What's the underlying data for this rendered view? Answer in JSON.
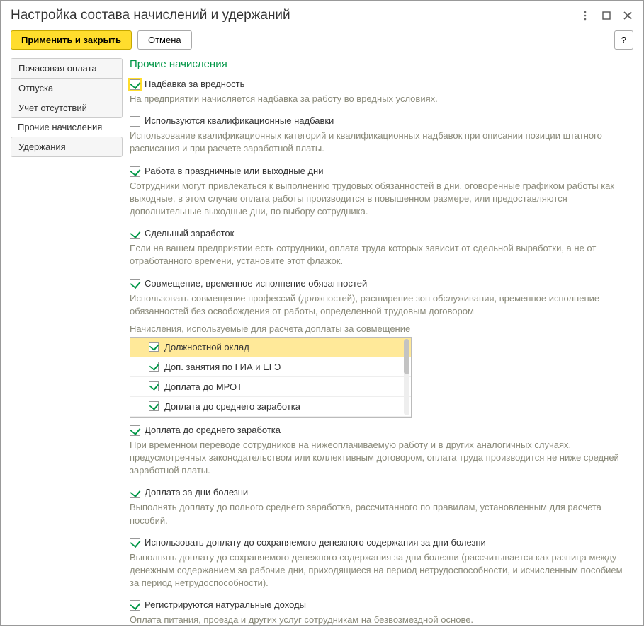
{
  "window": {
    "title": "Настройка состава начислений и удержаний"
  },
  "toolbar": {
    "apply_close": "Применить и закрыть",
    "cancel": "Отмена",
    "help": "?"
  },
  "nav": {
    "items": [
      "Почасовая оплата",
      "Отпуска",
      "Учет отсутствий",
      "Прочие начисления",
      "Удержания"
    ],
    "active_index": 3
  },
  "section": {
    "title": "Прочие начисления"
  },
  "options": {
    "hazard": {
      "label": "Надбавка за вредность",
      "desc": "На предприятии начисляется надбавка за работу во вредных условиях."
    },
    "qual": {
      "label": "Используются квалификационные надбавки",
      "desc": "Использование квалификационных категорий и квалификационных надбавок при описании позиции штатного расписания и при расчете заработной платы."
    },
    "holiday": {
      "label": "Работа в праздничные или выходные дни",
      "desc": "Сотрудники могут привлекаться к выполнению трудовых обязанностей в дни, оговоренные графиком работы как выходные, в этом случае оплата работы производится в повышенном размере, или предоставляются дополнительные выходные дни, по выбору сотрудника."
    },
    "piece": {
      "label": "Сдельный заработок",
      "desc": "Если на вашем предприятии есть сотрудники, оплата труда которых зависит от сдельной выработки, а не от отработанного времени, установите этот флажок."
    },
    "combo": {
      "label": "Совмещение, временное исполнение обязанностей",
      "desc": "Использовать совмещение профессий (должностей), расширение зон обслуживания, временное исполнение обязанностей без освобождения от работы, определенной трудовым договором"
    },
    "listbox_label": "Начисления, используемые для расчета доплаты за совмещение",
    "list": [
      "Должностной оклад",
      "Доп. занятия по ГИА и ЕГЭ",
      "Доплата до МРОТ",
      "Доплата до среднего заработка"
    ],
    "avg": {
      "label": "Доплата до среднего заработка",
      "desc": "При временном переводе сотрудников на нижеоплачиваемую работу и в других аналогичных случаях, предусмотренных законодательством или коллективным договором, оплата труда производится не ниже средней заработной платы."
    },
    "sick": {
      "label": "Доплата за дни болезни",
      "desc": "Выполнять доплату до полного среднего заработка, рассчитанного по правилам, установленным для расчета пособий."
    },
    "sick_keep": {
      "label": "Использовать доплату до сохраняемого денежного содержания за дни болезни",
      "desc": "Выполнять доплату до сохраняемого денежного содержания за дни болезни (рассчитывается как разница между денежным содержанием за рабочие дни, приходящиеся на период нетрудоспособности, и исчисленным пособием за период нетрудоспособности)."
    },
    "natural": {
      "label": "Регистрируются натуральные доходы",
      "desc": "Оплата питания, проезда и других услуг сотрудникам на безвозмездной основе."
    }
  }
}
